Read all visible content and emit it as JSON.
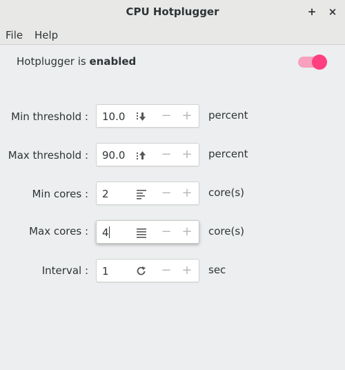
{
  "window": {
    "title": "CPU Hotplugger",
    "new_tab_glyph": "+",
    "close_glyph": "×"
  },
  "menu": {
    "items": [
      {
        "label": "File"
      },
      {
        "label": "Help"
      }
    ]
  },
  "status": {
    "prefix": "Hotplugger is ",
    "state": "enabled",
    "toggle_on": true,
    "accent_color": "#ff3f7f",
    "track_color": "#f7a1bd"
  },
  "settings": {
    "rows": [
      {
        "label": "Min threshold :",
        "value": "10.0",
        "icon": "sort-descending-icon",
        "unit": "percent"
      },
      {
        "label": "Max threshold :",
        "value": "90.0",
        "icon": "sort-ascending-icon",
        "unit": "percent"
      },
      {
        "label": "Min cores :",
        "value": "2",
        "icon": "align-left-icon",
        "unit": "core(s)"
      },
      {
        "label": "Max cores :",
        "value": "4",
        "icon": "justify-icon",
        "unit": "core(s)"
      },
      {
        "label": "Interval :",
        "value": "1",
        "icon": "refresh-icon",
        "unit": "sec"
      }
    ],
    "minus_glyph": "−",
    "plus_glyph": "+"
  }
}
